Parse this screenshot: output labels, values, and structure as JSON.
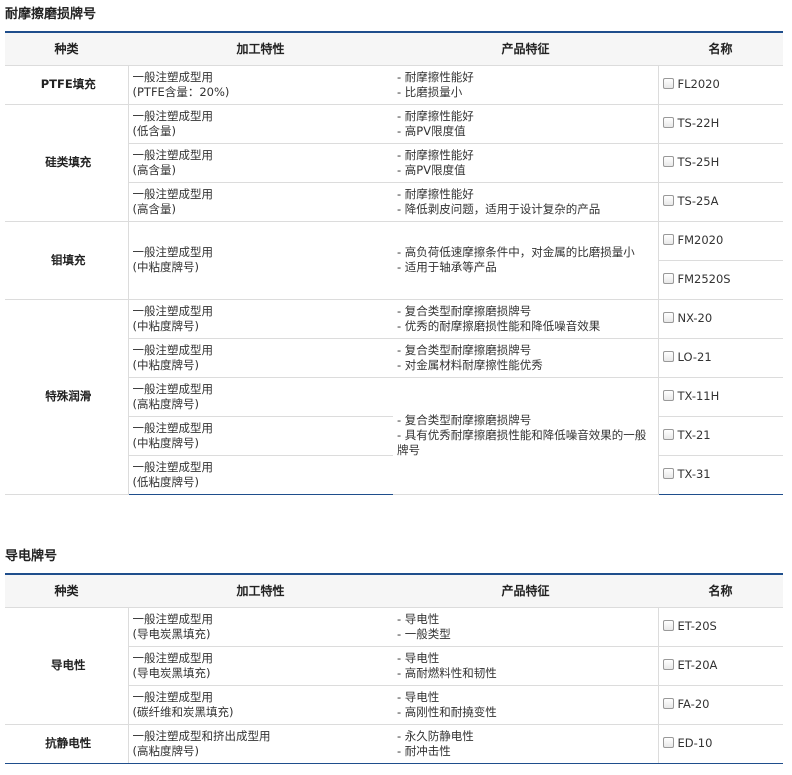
{
  "sections": [
    {
      "title": "耐摩擦磨损牌号",
      "headers": [
        "种类",
        "加工特性",
        "产品特征",
        "名称"
      ],
      "groups": [
        {
          "category": "PTFE填充",
          "rows": [
            {
              "proc": [
                "一般注塑成型用",
                "(PTFE含量：20%)"
              ],
              "feat": [
                "- 耐摩擦性能好",
                "- 比磨损量小"
              ],
              "name": "FL2020"
            }
          ]
        },
        {
          "category": "硅类填充",
          "rows": [
            {
              "proc": [
                "一般注塑成型用",
                "(低含量)"
              ],
              "feat": [
                "- 耐摩擦性能好",
                "- 高PV限度值"
              ],
              "name": "TS-22H"
            },
            {
              "proc": [
                "一般注塑成型用",
                "(高含量)"
              ],
              "feat": [
                "- 耐摩擦性能好",
                "- 高PV限度值"
              ],
              "name": "TS-25H"
            },
            {
              "proc": [
                "一般注塑成型用",
                "(高含量)"
              ],
              "feat": [
                "- 耐摩擦性能好",
                "- 降低剥皮问题，适用于设计复杂的产品"
              ],
              "name": "TS-25A"
            }
          ]
        },
        {
          "category": "钼填充",
          "shared_proc": [
            "一般注塑成型用",
            "(中粘度牌号)"
          ],
          "shared_feat": [
            "- 高负荷低速摩擦条件中，对金属的比磨损量小",
            "- 适用于轴承等产品"
          ],
          "names": [
            "FM2020",
            "FM2520S"
          ]
        },
        {
          "category": "特殊润滑",
          "rows": [
            {
              "proc": [
                "一般注塑成型用",
                "(中粘度牌号)"
              ],
              "feat": [
                "- 复合类型耐摩擦磨损牌号",
                "- 优秀的耐摩擦磨损性能和降低噪音效果"
              ],
              "name": "NX-20"
            },
            {
              "proc": [
                "一般注塑成型用",
                "(中粘度牌号)"
              ],
              "feat": [
                "- 复合类型耐摩擦磨损牌号",
                "- 对金属材料耐摩擦性能优秀"
              ],
              "name": "LO-21"
            }
          ],
          "merged_feat": [
            "- 复合类型耐摩擦磨损牌号",
            "- 具有优秀耐摩擦磨损性能和降低噪音效果的一般牌号"
          ],
          "merged_rows": [
            {
              "proc": [
                "一般注塑成型用",
                "(高粘度牌号)"
              ],
              "name": "TX-11H"
            },
            {
              "proc": [
                "一般注塑成型用",
                "(中粘度牌号)"
              ],
              "name": "TX-21"
            },
            {
              "proc": [
                "一般注塑成型用",
                "(低粘度牌号)"
              ],
              "name": "TX-31"
            }
          ]
        }
      ]
    },
    {
      "title": "导电牌号",
      "headers": [
        "种类",
        "加工特性",
        "产品特征",
        "名称"
      ],
      "groups": [
        {
          "category": "导电性",
          "rows": [
            {
              "proc": [
                "一般注塑成型用",
                "(导电炭黑填充)"
              ],
              "feat": [
                "- 导电性",
                "- 一般类型"
              ],
              "name": "ET-20S"
            },
            {
              "proc": [
                "一般注塑成型用",
                "(导电炭黑填充)"
              ],
              "feat": [
                "- 导电性",
                "- 高耐燃料性和韧性"
              ],
              "name": "ET-20A"
            },
            {
              "proc": [
                "一般注塑成型用",
                "(碳纤维和炭黑填充)"
              ],
              "feat": [
                "- 导电性",
                "- 高刚性和耐撓变性"
              ],
              "name": "FA-20"
            }
          ]
        },
        {
          "category": "抗静电性",
          "rows": [
            {
              "proc": [
                "一般注塑成型和挤出成型用",
                "(高粘度牌号)"
              ],
              "feat": [
                "- 永久防静电性",
                "- 耐冲击性"
              ],
              "name": "ED-10"
            }
          ]
        }
      ]
    }
  ]
}
